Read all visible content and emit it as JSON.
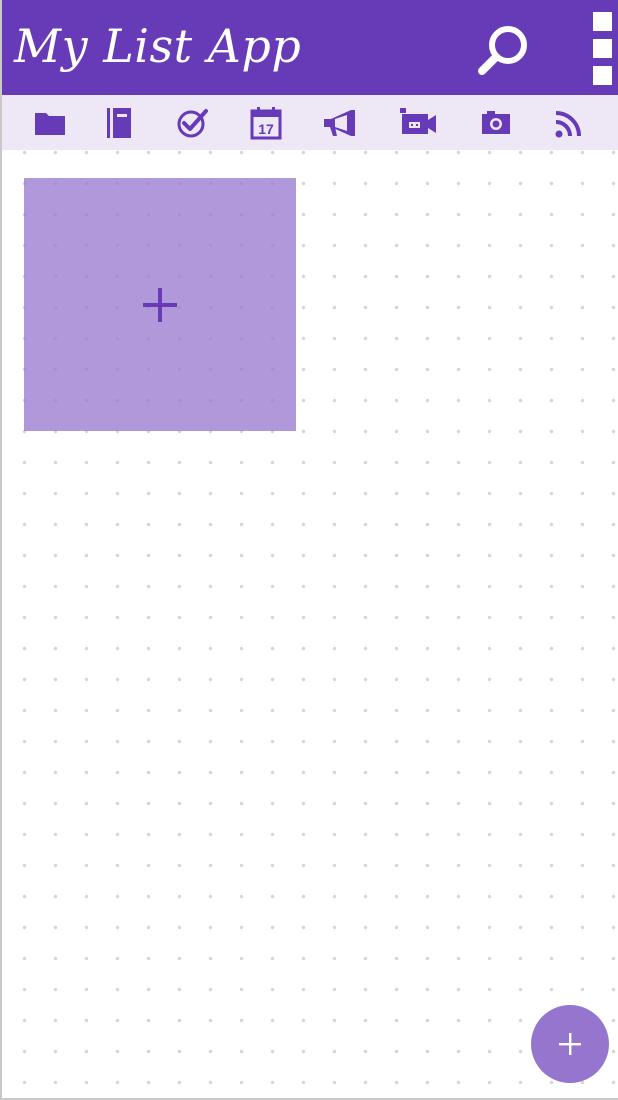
{
  "app_bar": {
    "title": "My List App",
    "actions": [
      {
        "icon": "search-icon"
      },
      {
        "icon": "more-vert-icon"
      }
    ]
  },
  "toolbar": {
    "items": [
      {
        "icon": "folder-icon"
      },
      {
        "icon": "notebook-icon"
      },
      {
        "icon": "check-circle-icon"
      },
      {
        "icon": "calendar-icon",
        "label": "17"
      },
      {
        "icon": "megaphone-icon"
      },
      {
        "icon": "video-camera-icon"
      },
      {
        "icon": "camera-icon"
      },
      {
        "icon": "rss-icon"
      }
    ]
  },
  "canvas": {
    "tiles": [
      {
        "type": "add-tile",
        "icon": "plus-icon"
      }
    ]
  },
  "fab": {
    "icon": "plus-icon"
  },
  "colors": {
    "primary": "#673ab7",
    "primary_light": "#ede7f6",
    "accent": "#9575cd",
    "icon_tint": "#673ab7",
    "dot_grid": "#d6d6d6"
  }
}
